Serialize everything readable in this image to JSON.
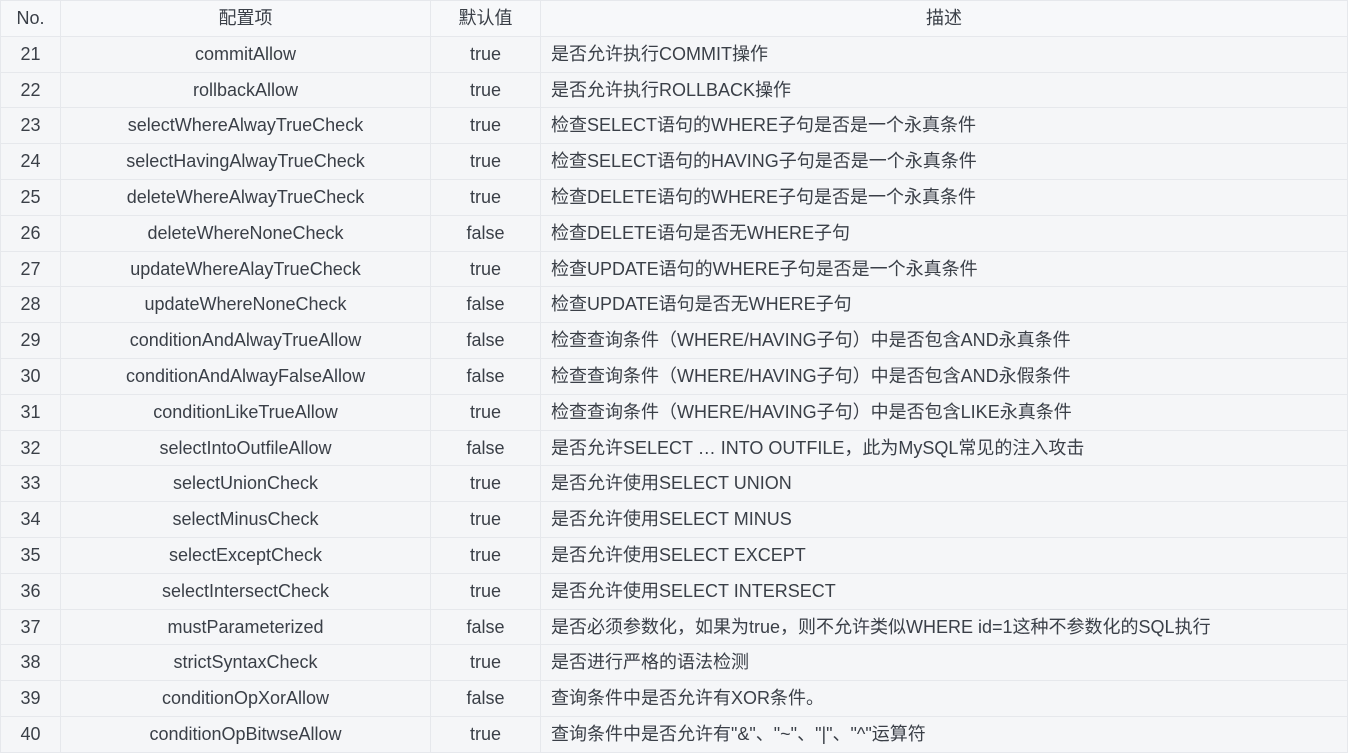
{
  "table": {
    "headers": {
      "no": "No.",
      "item": "配置项",
      "default": "默认值",
      "desc": "描述"
    },
    "rows": [
      {
        "no": "21",
        "item": "commitAllow",
        "default": "true",
        "desc": "是否允许执行COMMIT操作"
      },
      {
        "no": "22",
        "item": "rollbackAllow",
        "default": "true",
        "desc": "是否允许执行ROLLBACK操作"
      },
      {
        "no": "23",
        "item": "selectWhereAlwayTrueCheck",
        "default": "true",
        "desc": "检查SELECT语句的WHERE子句是否是一个永真条件"
      },
      {
        "no": "24",
        "item": "selectHavingAlwayTrueCheck",
        "default": "true",
        "desc": "检查SELECT语句的HAVING子句是否是一个永真条件"
      },
      {
        "no": "25",
        "item": "deleteWhereAlwayTrueCheck",
        "default": "true",
        "desc": "检查DELETE语句的WHERE子句是否是一个永真条件"
      },
      {
        "no": "26",
        "item": "deleteWhereNoneCheck",
        "default": "false",
        "desc": "检查DELETE语句是否无WHERE子句"
      },
      {
        "no": "27",
        "item": "updateWhereAlayTrueCheck",
        "default": "true",
        "desc": "检查UPDATE语句的WHERE子句是否是一个永真条件"
      },
      {
        "no": "28",
        "item": "updateWhereNoneCheck",
        "default": "false",
        "desc": "检查UPDATE语句是否无WHERE子句"
      },
      {
        "no": "29",
        "item": "conditionAndAlwayTrueAllow",
        "default": "false",
        "desc": "检查查询条件（WHERE/HAVING子句）中是否包含AND永真条件"
      },
      {
        "no": "30",
        "item": "conditionAndAlwayFalseAllow",
        "default": "false",
        "desc": "检查查询条件（WHERE/HAVING子句）中是否包含AND永假条件"
      },
      {
        "no": "31",
        "item": "conditionLikeTrueAllow",
        "default": "true",
        "desc": "检查查询条件（WHERE/HAVING子句）中是否包含LIKE永真条件"
      },
      {
        "no": "32",
        "item": "selectIntoOutfileAllow",
        "default": "false",
        "desc": "是否允许SELECT … INTO OUTFILE，此为MySQL常见的注入攻击"
      },
      {
        "no": "33",
        "item": "selectUnionCheck",
        "default": "true",
        "desc": "是否允许使用SELECT UNION"
      },
      {
        "no": "34",
        "item": "selectMinusCheck",
        "default": "true",
        "desc": "是否允许使用SELECT MINUS"
      },
      {
        "no": "35",
        "item": "selectExceptCheck",
        "default": "true",
        "desc": "是否允许使用SELECT EXCEPT"
      },
      {
        "no": "36",
        "item": "selectIntersectCheck",
        "default": "true",
        "desc": "是否允许使用SELECT INTERSECT"
      },
      {
        "no": "37",
        "item": "mustParameterized",
        "default": "false",
        "desc": "是否必须参数化，如果为true，则不允许类似WHERE  id=1这种不参数化的SQL执行"
      },
      {
        "no": "38",
        "item": "strictSyntaxCheck",
        "default": "true",
        "desc": "是否进行严格的语法检测"
      },
      {
        "no": "39",
        "item": "conditionOpXorAllow",
        "default": "false",
        "desc": "查询条件中是否允许有XOR条件。"
      },
      {
        "no": "40",
        "item": "conditionOpBitwseAllow",
        "default": "true",
        "desc": "查询条件中是否允许有\"&\"、\"~\"、\"|\"、\"^\"运算符"
      }
    ]
  }
}
